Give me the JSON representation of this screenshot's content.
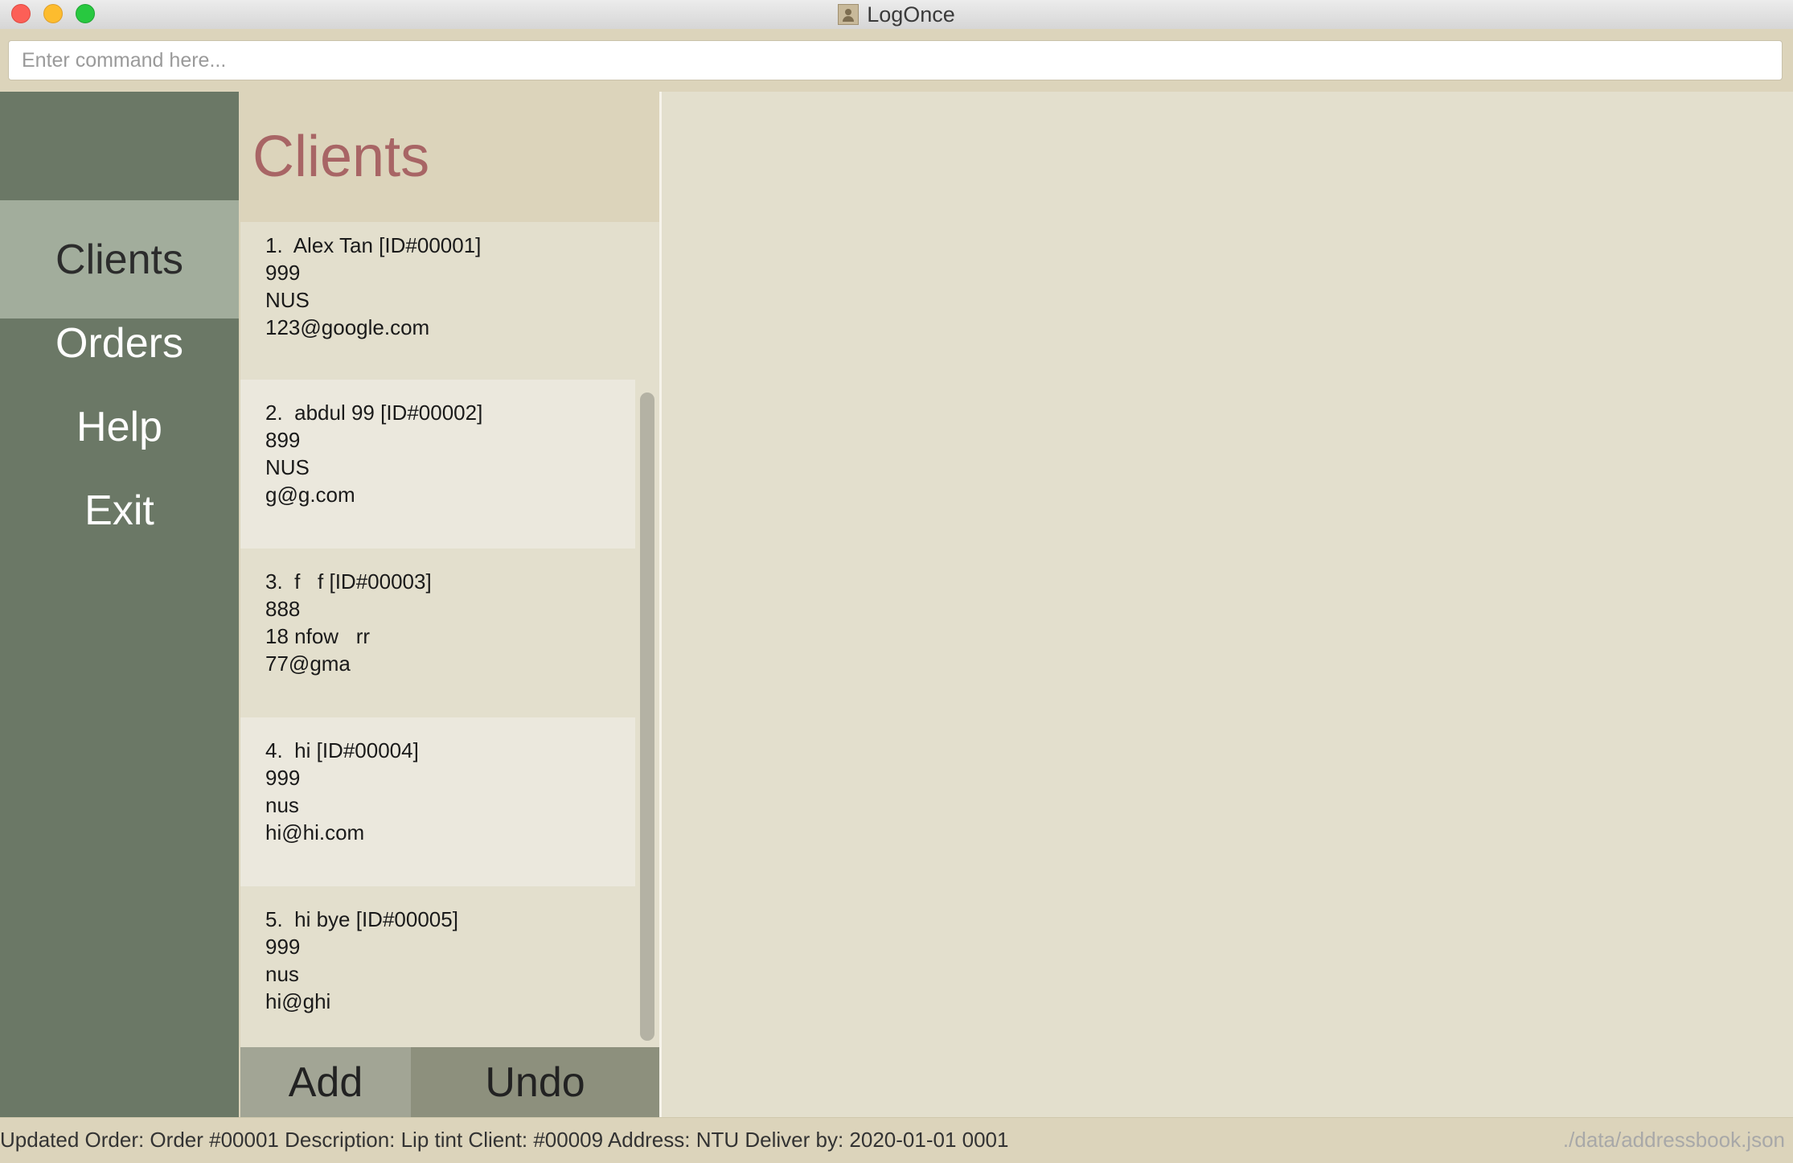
{
  "window": {
    "title": "LogOnce"
  },
  "command": {
    "placeholder": "Enter command here...",
    "value": ""
  },
  "sidebar": {
    "items": [
      {
        "label": "Clients",
        "active": true
      },
      {
        "label": "Orders",
        "active": false
      },
      {
        "label": "Help",
        "active": false
      },
      {
        "label": "Exit",
        "active": false
      }
    ]
  },
  "list": {
    "title": "Clients",
    "clients": [
      {
        "header": "1.  Alex Tan [ID#00001]",
        "phone": "999",
        "address": "NUS",
        "email": "123@google.com"
      },
      {
        "header": "2.  abdul 99 [ID#00002]",
        "phone": "899",
        "address": "NUS",
        "email": "g@g.com"
      },
      {
        "header": "3.  f   f [ID#00003]",
        "phone": "888",
        "address": "18 nfow   rr",
        "email": "77@gma"
      },
      {
        "header": "4.  hi [ID#00004]",
        "phone": "999",
        "address": "nus",
        "email": "hi@hi.com"
      },
      {
        "header": "5.  hi bye [ID#00005]",
        "phone": "999",
        "address": "nus",
        "email": "hi@ghi"
      }
    ],
    "add_label": "Add",
    "undo_label": "Undo"
  },
  "status": {
    "message": "Updated Order: Order #00001  Description: Lip tint Client: #00009 Address: NTU Deliver by: 2020-01-01 0001",
    "file_path": "./data/addressbook.json"
  },
  "colors": {
    "sidebar": "#6b7866",
    "sidebar_active": "#a2ad9c",
    "title_accent": "#a86565",
    "panel": "#e3dfcd",
    "header": "#dcd4bb"
  }
}
